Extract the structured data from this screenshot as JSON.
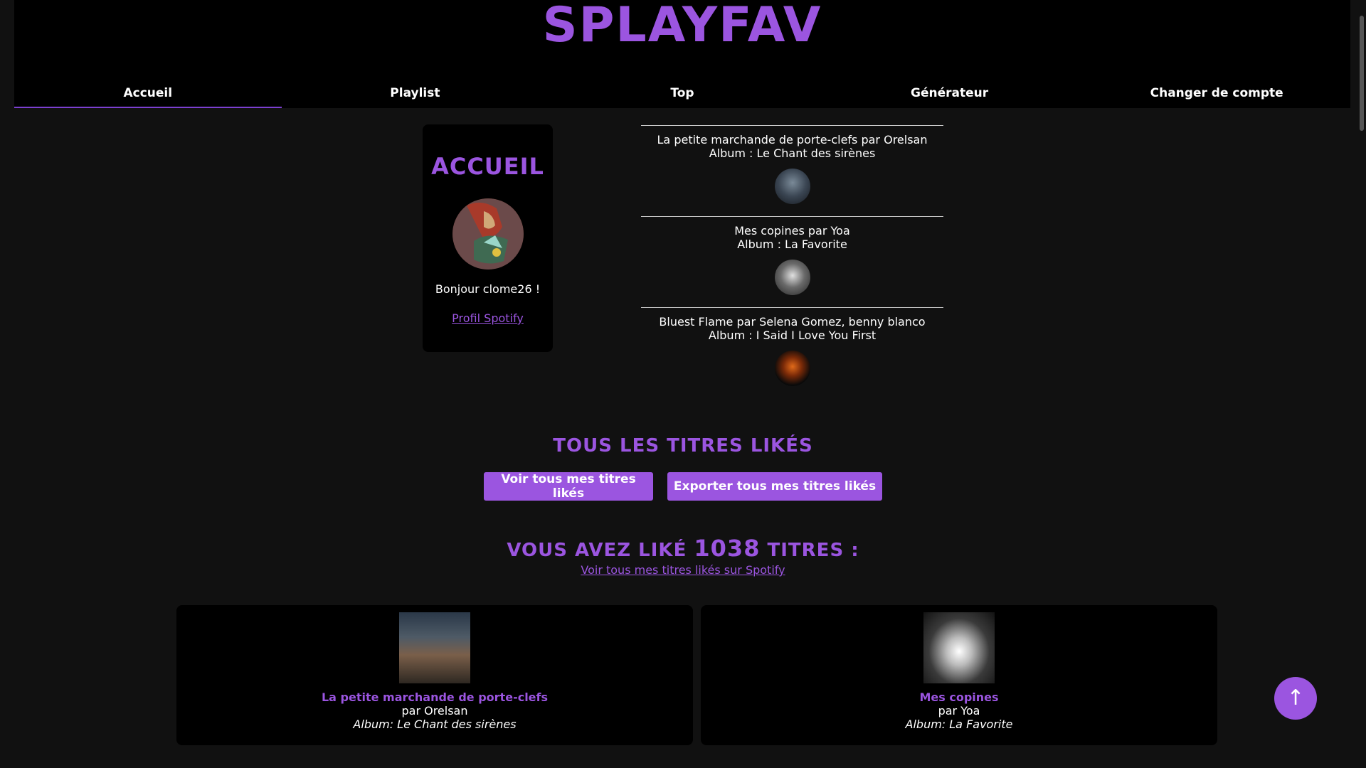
{
  "app": {
    "title": "SPLAYFAV"
  },
  "nav": {
    "tabs": [
      {
        "label": "Accueil",
        "active": true
      },
      {
        "label": "Playlist",
        "active": false
      },
      {
        "label": "Top",
        "active": false
      },
      {
        "label": "Générateur",
        "active": false
      },
      {
        "label": "Changer de compte",
        "active": false
      }
    ]
  },
  "profile": {
    "title": "ACCUEIL",
    "greeting": "Bonjour clome26 !",
    "link_label": "Profil Spotify"
  },
  "recent": [
    {
      "line1": "La petite marchande de porte-clefs par Orelsan",
      "line2": "Album : Le Chant des sirènes",
      "thumb": "orelsan-album-thumbnail"
    },
    {
      "line1": "Mes copines par Yoa",
      "line2": "Album : La Favorite",
      "thumb": "yoa-album-thumbnail"
    },
    {
      "line1": "Bluest Flame par Selena Gomez, benny blanco",
      "line2": "Album : I Said I Love You First",
      "thumb": "selena-album-thumbnail"
    }
  ],
  "liked": {
    "heading": "TOUS LES TITRES LIKÉS",
    "view_button": "Voir tous mes titres likés",
    "export_button": "Exporter tous mes titres likés",
    "count_prefix": "VOUS AVEZ LIKÉ",
    "count": "1038",
    "count_suffix": "TITRES :",
    "spotify_link": "Voir tous mes titres likés sur Spotify"
  },
  "tracks": [
    {
      "title": "La petite marchande de porte-clefs",
      "artist": "par Orelsan",
      "album": "Album: Le Chant des sirènes"
    },
    {
      "title": "Mes copines",
      "artist": "par Yoa",
      "album": "Album: La Favorite"
    }
  ],
  "scroll_top": {
    "icon": "arrow-up-icon",
    "glyph": "↑"
  },
  "colors": {
    "accent": "#9b55e0",
    "background": "#111111",
    "panel": "#000000"
  }
}
